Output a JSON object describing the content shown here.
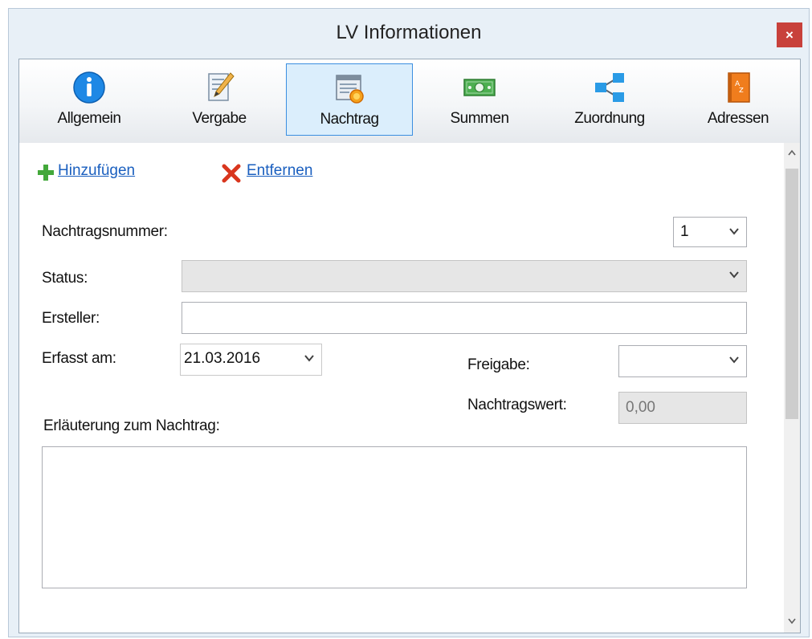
{
  "window": {
    "title": "LV Informationen",
    "close_label": "×"
  },
  "toolbar": {
    "tabs": [
      {
        "label": "Allgemein",
        "icon": "info-icon"
      },
      {
        "label": "Vergabe",
        "icon": "document-edit-icon"
      },
      {
        "label": "Nachtrag",
        "icon": "document-star-icon",
        "active": true
      },
      {
        "label": "Summen",
        "icon": "money-icon"
      },
      {
        "label": "Zuordnung",
        "icon": "share-tree-icon"
      },
      {
        "label": "Adressen",
        "icon": "address-book-icon"
      }
    ]
  },
  "actions": {
    "add_label": "Hinzufügen",
    "remove_label": "Entfernen"
  },
  "form": {
    "nachtragsnummer_label": "Nachtragsnummer:",
    "nachtragsnummer_value": "1",
    "status_label": "Status:",
    "status_value": "",
    "ersteller_label": "Ersteller:",
    "ersteller_value": "",
    "erfasst_label": "Erfasst am:",
    "erfasst_value": "21.03.2016",
    "freigabe_label": "Freigabe:",
    "freigabe_value": "",
    "nachtragswert_label": "Nachtragswert:",
    "nachtragswert_value": "0,00",
    "erlaeuterung_label": "Erläuterung zum Nachtrag:",
    "erlaeuterung_value": ""
  },
  "colors": {
    "accent": "#3b8ee0",
    "link": "#1a5fbf",
    "close": "#c8413b"
  }
}
